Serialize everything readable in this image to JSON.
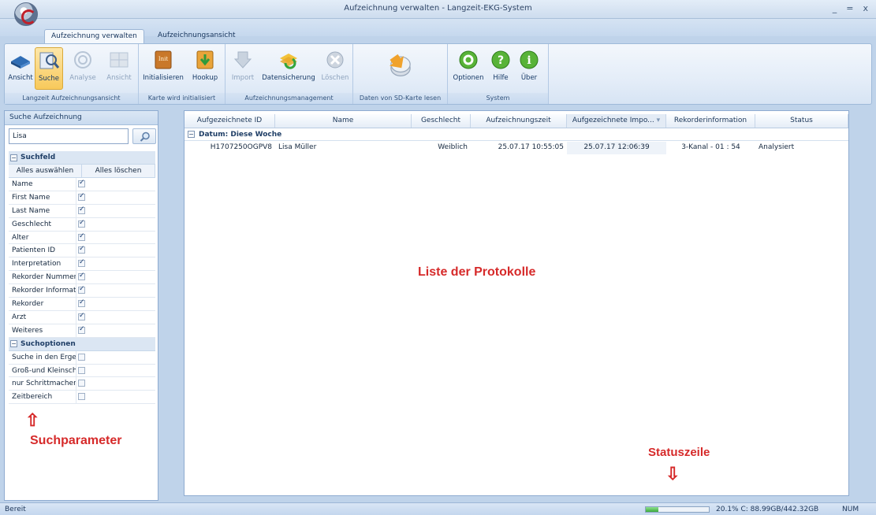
{
  "window": {
    "title": "Aufzeichnung verwalten  -  Langzeit-EKG-System",
    "controls": [
      "_",
      "=",
      "x"
    ]
  },
  "tabs": [
    {
      "label": "Aufzeichnung verwalten",
      "active": true
    },
    {
      "label": "Aufzeichnungsansicht",
      "active": false
    }
  ],
  "ribbon": {
    "groups": [
      {
        "label": "Langzeit Aufzeichnungsansicht",
        "buttons": [
          {
            "label": "Ansicht",
            "icon": "book-icon"
          },
          {
            "label": "Suche",
            "icon": "magnifier-icon",
            "selected": true
          },
          {
            "label": "Analyse",
            "icon": "analysis-icon",
            "disabled": true
          },
          {
            "label": "Ansicht",
            "icon": "grid-view-icon",
            "disabled": true
          }
        ]
      },
      {
        "label": "Karte wird initialisiert",
        "buttons": [
          {
            "label": "Initialisieren",
            "icon": "init-book-icon"
          },
          {
            "label": "Hookup",
            "icon": "hookup-arrow-icon"
          }
        ]
      },
      {
        "label": "Aufzeichnungsmanagement",
        "buttons": [
          {
            "label": "Import",
            "icon": "import-arrow-icon",
            "disabled": true
          },
          {
            "label": "Datensicherung",
            "icon": "backup-icon"
          },
          {
            "label": "Löschen",
            "icon": "delete-icon",
            "disabled": true
          }
        ]
      },
      {
        "label": "Daten von SD-Karte lesen",
        "buttons": [
          {
            "label": "",
            "icon": "sd-card-read-icon"
          }
        ]
      },
      {
        "label": "System",
        "buttons": [
          {
            "label": "Optionen",
            "icon": "options-gear-icon"
          },
          {
            "label": "Hilfe",
            "icon": "help-icon"
          },
          {
            "label": "Über",
            "icon": "info-icon"
          }
        ]
      }
    ]
  },
  "search_panel": {
    "header": "Suche Aufzeichnung",
    "query": "Lisa",
    "suchfeld": {
      "title": "Suchfeld",
      "select_all": "Alles auswählen",
      "clear_all": "Alles löschen",
      "fields": [
        {
          "name": "Name",
          "checked": true
        },
        {
          "name": "First Name",
          "checked": true
        },
        {
          "name": "Last Name",
          "checked": true
        },
        {
          "name": "Geschlecht",
          "checked": true
        },
        {
          "name": "Alter",
          "checked": true
        },
        {
          "name": "Patienten ID",
          "checked": true
        },
        {
          "name": "Interpretation",
          "checked": true
        },
        {
          "name": "Rekorder Nummer",
          "checked": true
        },
        {
          "name": "Rekorder Information",
          "checked": true
        },
        {
          "name": "Rekorder",
          "checked": true
        },
        {
          "name": "Arzt",
          "checked": true
        },
        {
          "name": "Weiteres",
          "checked": true
        }
      ]
    },
    "suchoptionen": {
      "title": "Suchoptionen",
      "options": [
        {
          "name": "Suche in den Ergebnissen",
          "checked": false
        },
        {
          "name": "Groß-und Kleinschreibung",
          "checked": false
        },
        {
          "name": "nur Schrittmacher",
          "checked": false
        },
        {
          "name": "Zeitbereich",
          "checked": false
        }
      ]
    }
  },
  "list": {
    "columns": [
      "Aufgezeichnete ID",
      "Name",
      "Geschlecht",
      "Aufzeichnungszeit",
      "Aufgezeichnete Impo...",
      "Rekorderinformation",
      "Status"
    ],
    "group_label": "Datum: Diese Woche",
    "rows": [
      [
        "H1707250OGPV8",
        "Lisa Müller",
        "Weiblich",
        "25.07.17  10:55:05",
        "25.07.17  12:06:39",
        "3-Kanal - 01 : 54",
        "Analysiert"
      ]
    ]
  },
  "annotations": {
    "list_label": "Liste der Protokolle",
    "search_label": "Suchparameter",
    "status_label": "Statuszeile",
    "arrow_up": "⇧",
    "arrow_down": "⇩"
  },
  "status_bar": {
    "text": "Bereit",
    "disk_fill_fraction": 0.201,
    "disk_text": "20.1%  C: 88.99GB/442.32GB",
    "num": "NUM"
  }
}
